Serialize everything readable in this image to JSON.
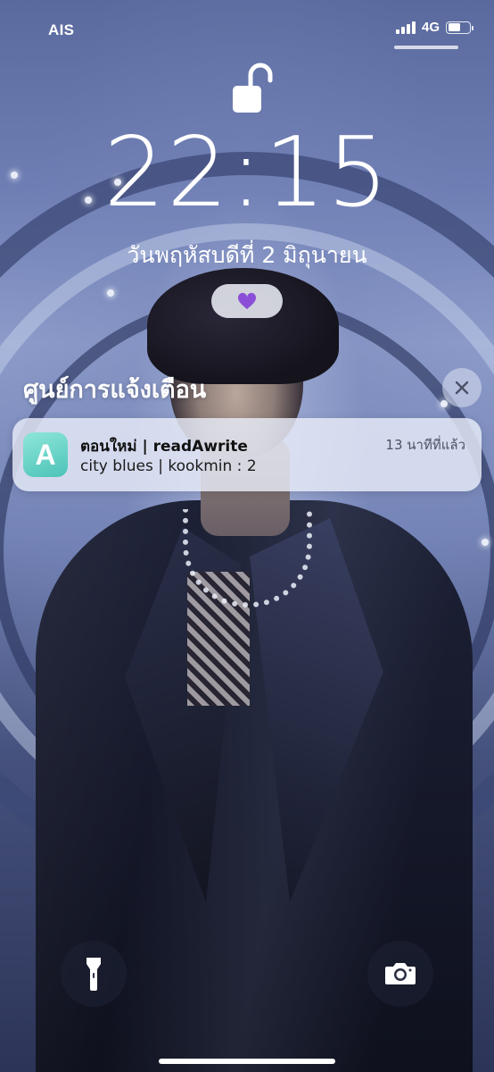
{
  "status_bar": {
    "carrier": "AIS",
    "network": "4G",
    "signal_bars": 4,
    "battery_level": 0.6
  },
  "lock_screen": {
    "lock_icon": "unlock-icon",
    "time": "22:15",
    "date": "วันพฤหัสบดีที่ 2 มิถุนายน",
    "focus_icon": "heart-icon",
    "focus_color": "#8a4fd6"
  },
  "notification_center": {
    "title": "ศูนย์การแจ้งเตือน",
    "clear_icon": "close-icon",
    "notifications": [
      {
        "app_icon": "readawrite-app-icon",
        "app_icon_letter": "A",
        "app_icon_color": "#4cc3b8",
        "title": "ตอนใหม่ | readAwrite",
        "time": "13 นาทีที่แล้ว",
        "body": "city blues | kookmin : 2"
      }
    ]
  },
  "quick_actions": {
    "left_icon": "flashlight-icon",
    "right_icon": "camera-icon"
  }
}
